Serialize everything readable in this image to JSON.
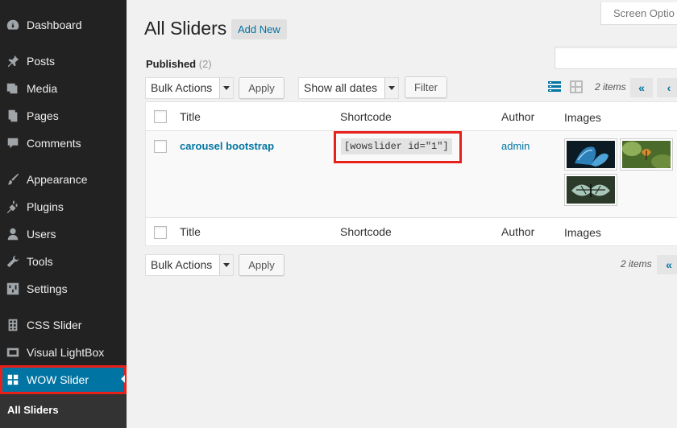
{
  "sidebar": {
    "items": [
      {
        "label": "Dashboard",
        "icon": "dashboard-icon"
      },
      {
        "label": "Posts",
        "icon": "pin-icon"
      },
      {
        "label": "Media",
        "icon": "media-icon"
      },
      {
        "label": "Pages",
        "icon": "pages-icon"
      },
      {
        "label": "Comments",
        "icon": "comment-icon"
      },
      {
        "label": "Appearance",
        "icon": "brush-icon"
      },
      {
        "label": "Plugins",
        "icon": "plugin-icon"
      },
      {
        "label": "Users",
        "icon": "user-icon"
      },
      {
        "label": "Tools",
        "icon": "wrench-icon"
      },
      {
        "label": "Settings",
        "icon": "settings-icon"
      },
      {
        "label": "CSS Slider",
        "icon": "grid-icon"
      },
      {
        "label": "Visual LightBox",
        "icon": "camera-icon"
      },
      {
        "label": "WOW Slider",
        "icon": "slider-icon",
        "active": true
      }
    ],
    "submenu": {
      "label": "All Sliders"
    }
  },
  "header": {
    "screen_options": "Screen Optio",
    "title": "All Sliders",
    "add_new": "Add New"
  },
  "filters": {
    "published_label": "Published",
    "published_count": "(2)",
    "bulk_actions": "Bulk Actions",
    "apply": "Apply",
    "dates": "Show all dates",
    "filter": "Filter",
    "items_count": "2 items",
    "pager_first": "«",
    "pager_prev": "‹"
  },
  "table": {
    "columns": [
      "Title",
      "Shortcode",
      "Author",
      "Images"
    ],
    "rows": [
      {
        "title": "carousel bootstrap",
        "shortcode": "[wowslider id=\"1\"]",
        "author": "admin"
      }
    ]
  },
  "footer": {
    "bulk_actions": "Bulk Actions",
    "apply": "Apply",
    "items_count": "2 items",
    "pager_first": "«"
  },
  "colors": {
    "accent": "#0074a2",
    "highlight": "#e8201a",
    "sidebar_bg": "#222222"
  }
}
